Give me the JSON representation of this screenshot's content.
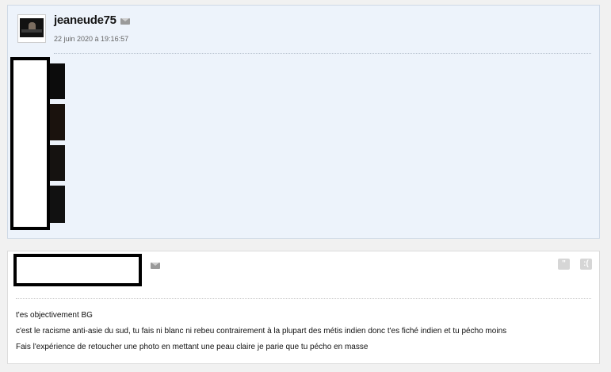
{
  "posts": [
    {
      "username": "jeaneude75",
      "date": "22 juin 2020 à 19:16:57",
      "icons": [
        "mail-icon"
      ]
    },
    {
      "icons": [
        "mail-icon",
        "quote-icon",
        "smiley-icon"
      ],
      "message": [
        "t'es objectivement BG",
        "c'est le racisme anti-asie du sud, tu fais ni blanc ni rebeu contrairement à la plupart des métis indien donc t'es fiché indien et tu pécho moins",
        "Fais l'expérience de retoucher une photo en mettant une peau claire je parie que tu pécho en masse"
      ]
    }
  ],
  "colors": {
    "post_highlight_bg": "#edf3fb",
    "post_bg": "#ffffff",
    "page_bg": "#f1f1f1"
  }
}
